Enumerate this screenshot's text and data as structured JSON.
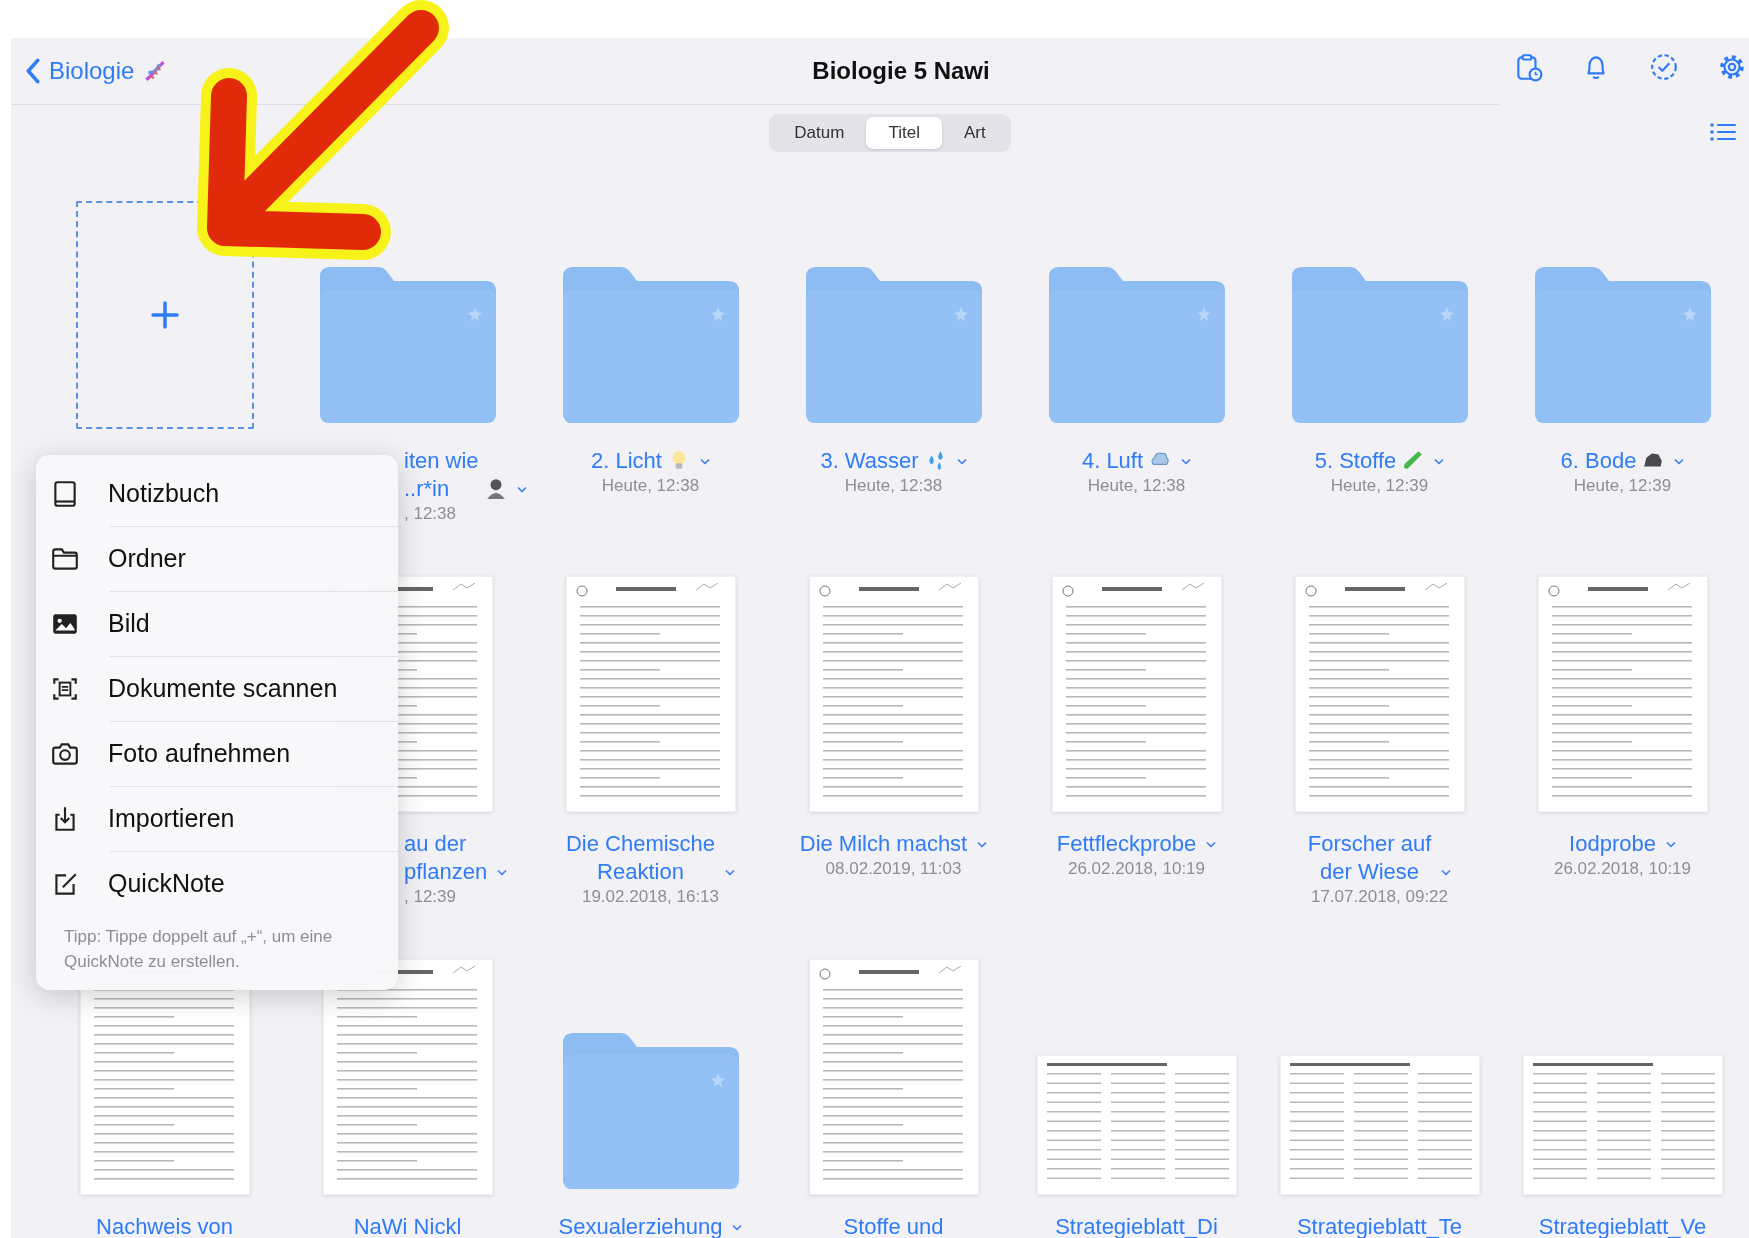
{
  "nav": {
    "back_label": "Biologie",
    "title": "Biologie 5 Nawi"
  },
  "sort_tabs": [
    {
      "label": "Datum",
      "selected": false
    },
    {
      "label": "Titel",
      "selected": true
    },
    {
      "label": "Art",
      "selected": false
    }
  ],
  "rows": [
    [
      {
        "kind": "new"
      },
      {
        "kind": "folder",
        "title_lines": [
          "iten wie",
          "..r*in"
        ],
        "date": ", 12:38"
      },
      {
        "kind": "folder",
        "title_lines": [
          "2. Licht"
        ],
        "date": "Heute, 12:38"
      },
      {
        "kind": "folder",
        "title_lines": [
          "3. Wasser"
        ],
        "date": "Heute, 12:38"
      },
      {
        "kind": "folder",
        "title_lines": [
          "4. Luft"
        ],
        "date": "Heute, 12:38"
      },
      {
        "kind": "folder",
        "title_lines": [
          "5. Stoffe"
        ],
        "date": "Heute, 12:39"
      },
      {
        "kind": "folder",
        "title_lines": [
          "6. Bode"
        ],
        "date": "Heute, 12:39"
      }
    ],
    [
      {
        "kind": "document",
        "title_lines": [
          "au der",
          "pflanzen"
        ],
        "date": ", 12:39"
      },
      {
        "kind": "document",
        "title_lines": [
          "Die Chemische",
          "Reaktion"
        ],
        "date": "19.02.2018, 16:13"
      },
      {
        "kind": "document",
        "title_lines": [
          "Die Milch machst"
        ],
        "date": "08.02.2019, 11:03"
      },
      {
        "kind": "document",
        "title_lines": [
          "Fettfleckprobe"
        ],
        "date": "26.02.2018, 10:19"
      },
      {
        "kind": "document",
        "title_lines": [
          "Forscher auf",
          "der Wiese"
        ],
        "date": "17.07.2018, 09:22"
      },
      {
        "kind": "document",
        "title_lines": [
          "Iodprobe"
        ],
        "date": "26.02.2018, 10:19"
      }
    ],
    [
      {
        "kind": "document",
        "title_lines": [
          "Nachweis von"
        ]
      },
      {
        "kind": "document",
        "title_lines": [
          "NaWi Nickl"
        ]
      },
      {
        "kind": "folder",
        "title_lines": [
          "Sexualerziehung"
        ],
        "chevron": true
      },
      {
        "kind": "document",
        "title_lines": [
          "Stoffe und"
        ]
      },
      {
        "kind": "wide_document",
        "title_lines": [
          "Strategieblatt_Di"
        ]
      },
      {
        "kind": "wide_document",
        "title_lines": [
          "Strategieblatt_Te"
        ]
      },
      {
        "kind": "wide_document",
        "title_lines": [
          "Strategieblatt_Ve"
        ]
      }
    ]
  ],
  "menu": {
    "items": [
      {
        "label": "Notizbuch"
      },
      {
        "label": "Ordner"
      },
      {
        "label": "Bild"
      },
      {
        "label": "Dokumente scannen"
      },
      {
        "label": "Foto aufnehmen"
      },
      {
        "label": "Importieren"
      },
      {
        "label": "QuickNote"
      }
    ],
    "tip": "Tipp: Tippe doppelt auf „+“, um eine QuickNote zu erstellen."
  }
}
